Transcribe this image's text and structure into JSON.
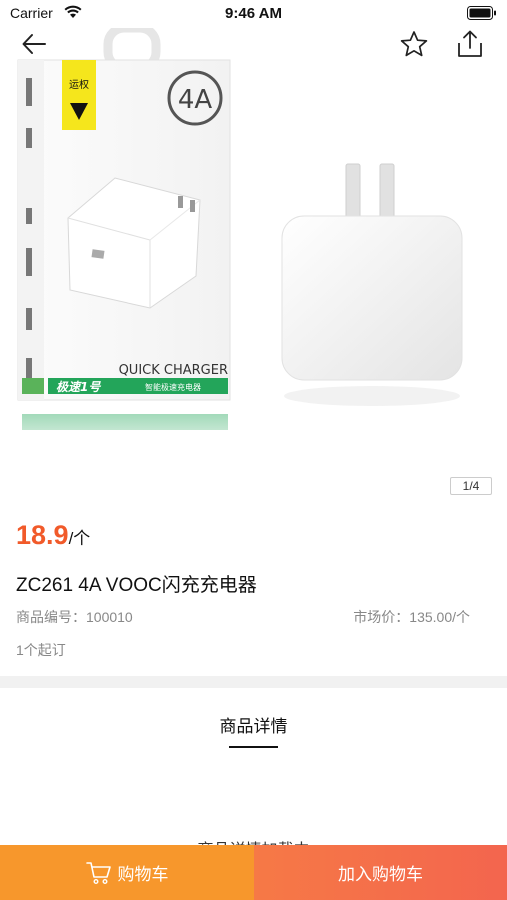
{
  "status_bar": {
    "carrier": "Carrier",
    "time": "9:46 AM"
  },
  "nav": {
    "back_icon": "arrow-left-icon",
    "favorite_icon": "star-outline-icon",
    "share_icon": "share-icon"
  },
  "gallery": {
    "page_indicator": "1/4",
    "box_brand": "运权",
    "box_rating": "4A",
    "box_text": "QUICK CHARGER",
    "box_subtext": "极速1号",
    "box_subtext2": "智能极速充电器"
  },
  "product": {
    "price": "18.9",
    "unit": "/个",
    "title": "ZC261 4A VOOC闪充充电器",
    "code_label": "商品编号：100010",
    "market_price": "市场价：135.00/个",
    "moq": "1个起订"
  },
  "detail": {
    "tab_label": "商品详情",
    "loading_text": "商品详情加载中"
  },
  "bottom_bar": {
    "cart_label": "购物车",
    "add_to_cart_label": "加入购物车"
  },
  "colors": {
    "price": "#f15a2a",
    "cart_button": "#f7972c",
    "add_to_cart_button": "#f3654e"
  }
}
